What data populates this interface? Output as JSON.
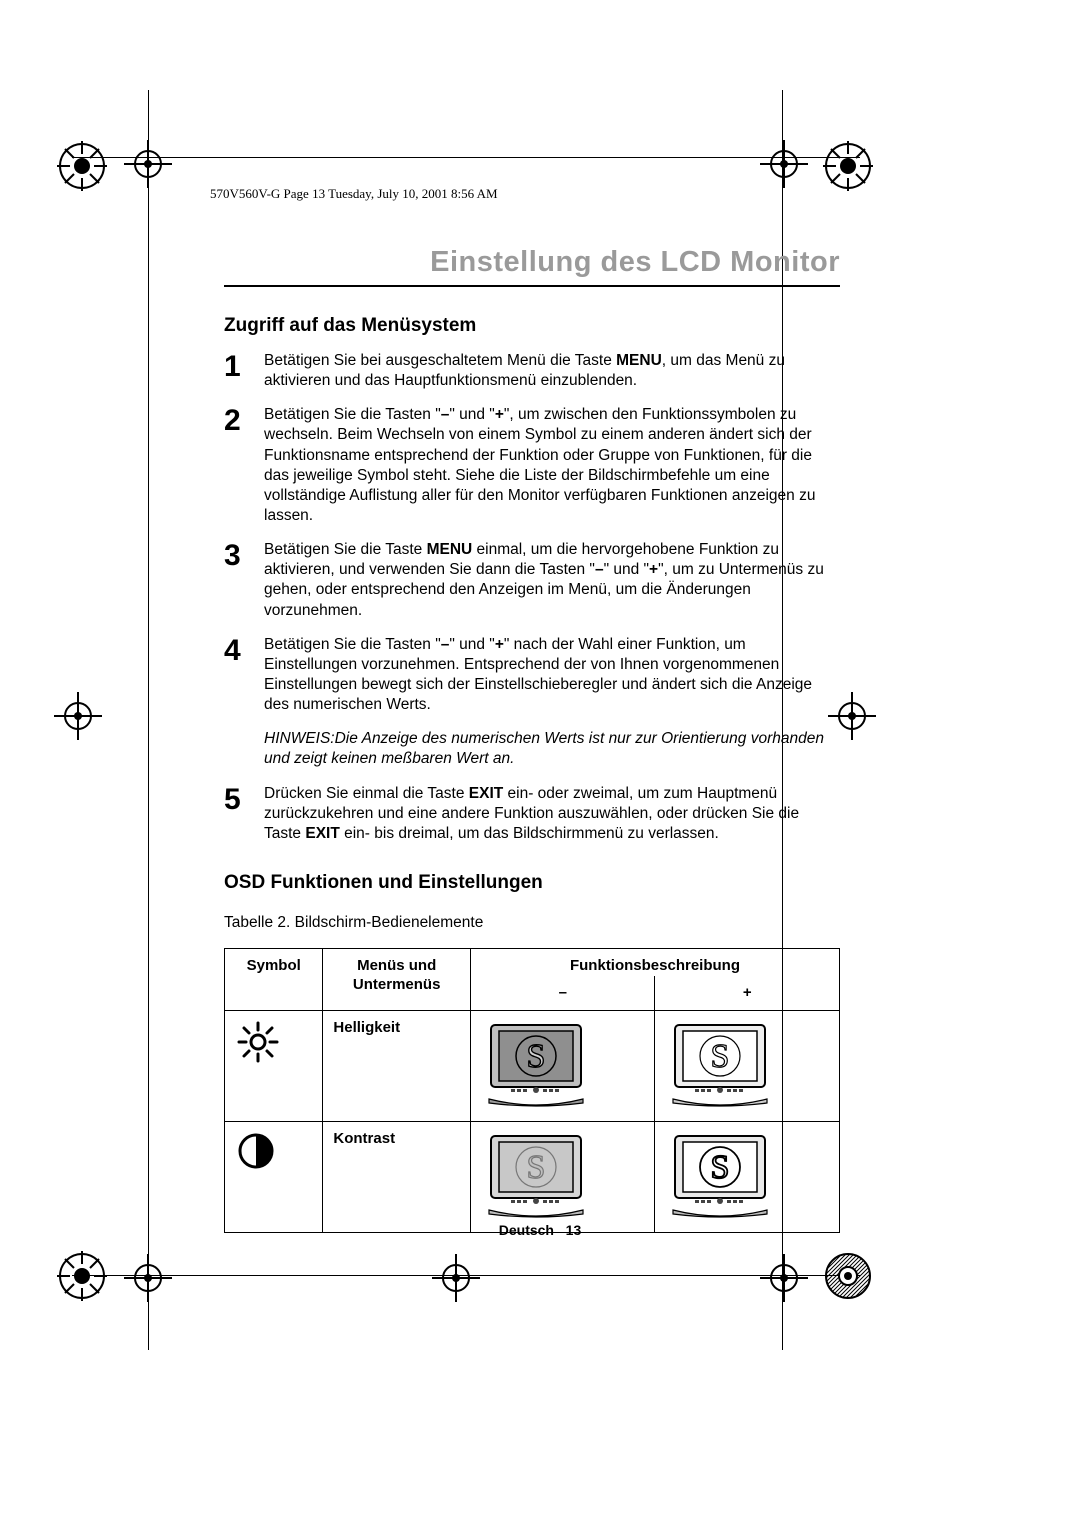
{
  "meta": {
    "header_line": "570V560V-G  Page 13  Tuesday, July 10, 2001  8:56 AM"
  },
  "title": "Einstellung des LCD Monitor",
  "section1": {
    "heading": "Zugriff auf das Menüsystem",
    "steps": [
      {
        "n": "1",
        "html": "Betätigen Sie bei ausgeschaltetem Menü die Taste <b>MENU</b>, um das Menü zu aktivieren und das Hauptfunktionsmenü einzublenden."
      },
      {
        "n": "2",
        "html": "Betätigen Sie die Tasten \"<b>–</b>\" und \"<b>+</b>\", um zwischen den Funktionssymbolen zu wechseln. Beim Wechseln von einem Symbol zu einem anderen ändert sich der Funktionsname entsprechend der Funktion oder Gruppe von Funktionen, für die das jeweilige Symbol steht. Siehe die Liste der Bildschirmbefehle um eine vollständige Auflistung aller für den Monitor verfügbaren Funktionen anzeigen zu lassen."
      },
      {
        "n": "3",
        "html": "Betätigen Sie die Taste <b>MENU</b> einmal, um die hervorgehobene Funktion zu aktivieren, und verwenden Sie dann die Tasten \"<b>–</b>\" und \"<b>+</b>\", um zu Untermenüs zu gehen, oder entsprechend den Anzeigen im Menü, um die Änderungen vorzunehmen."
      },
      {
        "n": "4",
        "html": "Betätigen Sie die Tasten \"<b>–</b>\" und \"<b>+</b>\" nach der Wahl einer Funktion, um Einstellungen vorzunehmen. Entsprechend der von Ihnen vorgenommenen Einstellungen bewegt sich der Einstellschieberegler und ändert sich die Anzeige des numerischen Werts."
      },
      {
        "n": "5",
        "html": "Drücken Sie einmal die Taste <b>EXIT</b> ein- oder zweimal, um zum Hauptmenü zurückzukehren und eine andere Funktion auszuwählen, oder drücken Sie die Taste <b>EXIT</b> ein- bis dreimal, um das Bildschirmmenü zu verlassen."
      }
    ],
    "hinweis": "HINWEIS:Die Anzeige des numerischen Werts ist nur zur Orientierung vorhanden und zeigt keinen meßbaren Wert an."
  },
  "section2": {
    "heading": "OSD Funktionen und Einstellungen",
    "caption": "Tabelle 2.  Bildschirm-Bedienelemente",
    "columns": {
      "symbol": "Symbol",
      "menus": "Menüs und Untermenüs",
      "fn": "Funktionsbeschreibung",
      "minus": "–",
      "plus": "+"
    },
    "rows": [
      {
        "icon": "brightness",
        "name": "Helligkeit",
        "minus": "dark",
        "plus": "light"
      },
      {
        "icon": "contrast",
        "name": "Kontrast",
        "minus": "low",
        "plus": "high"
      }
    ]
  },
  "footer": {
    "language": "Deutsch",
    "page": "13"
  }
}
